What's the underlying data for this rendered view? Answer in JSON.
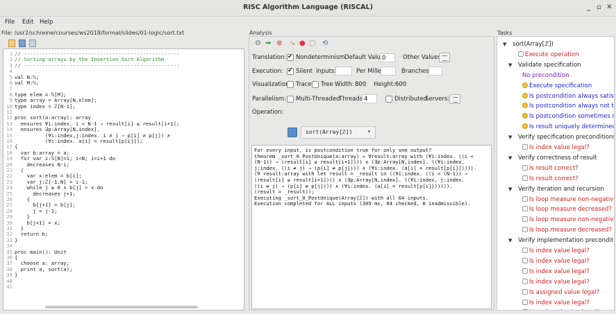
{
  "window": {
    "title": "RISC Algorithm Language (RISCAL)",
    "min_label": "_",
    "max_label": "▫",
    "close_label": "✕"
  },
  "menu": {
    "file": "File",
    "edit": "Edit",
    "help": "Help"
  },
  "editor": {
    "file_label": "File: /usr2/schreine/courses/ws2018/formal/slides/01-logic/sort.txt",
    "lines": [
      {
        "n": "1",
        "t": "// ---------------------------------------------------",
        "k": "comment"
      },
      {
        "n": "2",
        "t": "// Sorting arrays by the Insertion Sort Algorithm",
        "k": "comment"
      },
      {
        "n": "3",
        "t": "// ---------------------------------------------------",
        "k": "comment"
      },
      {
        "n": "4",
        "t": "",
        "k": "code"
      },
      {
        "n": "5",
        "t": "val N:ℕ;",
        "k": "code"
      },
      {
        "n": "6",
        "t": "val M:ℕ;",
        "k": "code"
      },
      {
        "n": "7",
        "t": "",
        "k": "code"
      },
      {
        "n": "8",
        "t": "type elem = ℕ[M];",
        "k": "code"
      },
      {
        "n": "9",
        "t": "type array = Array[N,elem];",
        "k": "code"
      },
      {
        "n": "10",
        "t": "type index = ℤ[N-1];",
        "k": "code"
      },
      {
        "n": "11",
        "t": "",
        "k": "code"
      },
      {
        "n": "12",
        "t": "proc sort(a:array): array",
        "k": "code"
      },
      {
        "n": "13",
        "t": "  ensures ∀i:index. i < N-1 ⇒ result[i] ≤ result[i+1];",
        "k": "code"
      },
      {
        "n": "14",
        "t": "  ensures ∃p:Array[N,index].",
        "k": "code"
      },
      {
        "n": "15",
        "t": "          (∀i:index,j:index. i ≠ j ⇒ p[i] ≠ p[j]) ∧",
        "k": "code"
      },
      {
        "n": "16",
        "t": "          (∀i:index. a[i] = result[p[i]]);",
        "k": "code"
      },
      {
        "n": "17",
        "t": "{",
        "k": "code"
      },
      {
        "n": "18",
        "t": "  var b:array = a;",
        "k": "code"
      },
      {
        "n": "19",
        "t": "  for var i:ℕ[N]=1; i<N; i=i+1 do",
        "k": "code"
      },
      {
        "n": "20",
        "t": "    decreases N-i;",
        "k": "code"
      },
      {
        "n": "21",
        "t": "  {",
        "k": "code"
      },
      {
        "n": "22",
        "t": "    var x:elem = b[i];",
        "k": "code"
      },
      {
        "n": "23",
        "t": "    var j:ℤ[-1,N] = i-1;",
        "k": "code"
      },
      {
        "n": "24",
        "t": "    while j ≥ 0 ∧ b[j] > x do",
        "k": "code"
      },
      {
        "n": "25",
        "t": "      decreases j+1;",
        "k": "code"
      },
      {
        "n": "26",
        "t": "    {",
        "k": "code"
      },
      {
        "n": "27",
        "t": "      b[j+1] = b[j];",
        "k": "code"
      },
      {
        "n": "28",
        "t": "      j = j-1;",
        "k": "code"
      },
      {
        "n": "29",
        "t": "    }",
        "k": "code"
      },
      {
        "n": "30",
        "t": "    b[j+1] = x;",
        "k": "code"
      },
      {
        "n": "31",
        "t": "  }",
        "k": "code"
      },
      {
        "n": "32",
        "t": "  return b;",
        "k": "code"
      },
      {
        "n": "33",
        "t": "}",
        "k": "code"
      },
      {
        "n": "34",
        "t": "",
        "k": "code"
      },
      {
        "n": "35",
        "t": "proc main(): Unit",
        "k": "code"
      },
      {
        "n": "36",
        "t": "{",
        "k": "code"
      },
      {
        "n": "37",
        "t": "  choose a: array;",
        "k": "code"
      },
      {
        "n": "38",
        "t": "  print a, sort(a);",
        "k": "code"
      },
      {
        "n": "39",
        "t": "}",
        "k": "code"
      },
      {
        "n": "40",
        "t": "",
        "k": "code"
      },
      {
        "n": "41",
        "t": "",
        "k": "code"
      }
    ]
  },
  "analysis": {
    "label": "Analysis",
    "translation_label": "Translation:",
    "nondeterminism_label": "Nondeterminism",
    "default_value_label": "Default Value:",
    "default_value": "0",
    "other_values_label": "Other Values:",
    "execution_label": "Execution:",
    "silent_label": "Silent",
    "inputs_label": "Inputs:",
    "per_mille_label": "Per Mille:",
    "branches_label": "Branches:",
    "visualization_label": "Visualization:",
    "trace_label": "Trace",
    "tree_label": "Tree",
    "width_label": "Width:",
    "width_value": "800",
    "height_label": "Height:",
    "height_value": "600",
    "parallelism_label": "Parallelism:",
    "multithreaded_label": "Multi-Threaded",
    "threads_label": "Threads:",
    "threads_value": "4",
    "distributed_label": "Distributed",
    "servers_label": "Servers:",
    "operation_label": "Operation:",
    "operation_value": "sort(Array[ℤ])",
    "output_lines": [
      "For every input, is postcondition true for only one output?",
      "theorem _sort_0_PostUnique(a:array) ⇔ ∀result:array with (∀i:index. ((i <",
      "(N-1)) ⇒ (result[i] ≤ result[i+1]))) ∧ (∃p:Array[N,index]. ((∀i:index,",
      "j:index. ((i ≠ j) ⇒ (p[i] ≠ p[j]))) ∧ (∀i:index. (a[i] = result[p[i]])))).",
      "(∀ result:array with let result = _result in ((∀i:index. ((i < (N-1)) ⇒",
      "(result[i] ≤ result[i+1]))) ∧ (∃p:Array[N,index]. ((∀i:index, j:index.",
      "((i ≠ j) ⇒ (p[i] ≠ p[j]))) ∧ (∀i:index. (a[i] = result[p[i]]))))).",
      "(result = _result));",
      "Executing _sort_0_PostUnique(Array[ℤ]) with all 64 inputs.",
      "Execution completed for ALL inputs (305 ms, 64 checked, 0 inadmissible)."
    ]
  },
  "tasks": {
    "label": "Tasks",
    "items": [
      {
        "text": "sort(Array[ℤ])",
        "color": "black",
        "icon": "",
        "level": 0,
        "tri": "▼"
      },
      {
        "text": "Execute operation",
        "color": "red",
        "icon": "lock",
        "level": 1,
        "tri": ""
      },
      {
        "text": "Validate specification",
        "color": "black",
        "icon": "",
        "level": 1,
        "tri": "▼"
      },
      {
        "text": "No precondition",
        "color": "purple",
        "icon": "",
        "level": 2,
        "tri": ""
      },
      {
        "text": "Execute specification",
        "color": "blue",
        "icon": "gear",
        "level": 2,
        "tri": ""
      },
      {
        "text": "Is postcondition always satisfiable?",
        "color": "blue",
        "icon": "gear",
        "level": 2,
        "tri": ""
      },
      {
        "text": "Is postcondition always not trivial?",
        "color": "blue",
        "icon": "gear",
        "level": 2,
        "tri": ""
      },
      {
        "text": "Is postcondition sometimes not triv",
        "color": "blue",
        "icon": "gear",
        "level": 2,
        "tri": ""
      },
      {
        "text": "Is result uniquely determined?",
        "color": "blue",
        "icon": "gear",
        "level": 2,
        "tri": ""
      },
      {
        "text": "Verify specification preconditions",
        "color": "black",
        "icon": "",
        "level": 1,
        "tri": "▼"
      },
      {
        "text": "Is index value legal?",
        "color": "red",
        "icon": "lock",
        "level": 2,
        "tri": ""
      },
      {
        "text": "Verify correctness of result",
        "color": "black",
        "icon": "",
        "level": 1,
        "tri": "▼"
      },
      {
        "text": "Is result correct?",
        "color": "red",
        "icon": "lock",
        "level": 2,
        "tri": ""
      },
      {
        "text": "Is result correct?",
        "color": "red",
        "icon": "lock",
        "level": 2,
        "tri": ""
      },
      {
        "text": "Verify iteration and recursion",
        "color": "black",
        "icon": "",
        "level": 1,
        "tri": "▼"
      },
      {
        "text": "Is loop measure non-negative?",
        "color": "red",
        "icon": "lock",
        "level": 2,
        "tri": ""
      },
      {
        "text": "Is loop measure decreased?",
        "color": "red",
        "icon": "lock",
        "level": 2,
        "tri": ""
      },
      {
        "text": "Is loop measure non-negative?",
        "color": "red",
        "icon": "lock",
        "level": 2,
        "tri": ""
      },
      {
        "text": "Is loop measure decreased?",
        "color": "red",
        "icon": "lock",
        "level": 2,
        "tri": ""
      },
      {
        "text": "Verify implementation preconditions",
        "color": "black",
        "icon": "",
        "level": 1,
        "tri": "▼"
      },
      {
        "text": "Is index value legal?",
        "color": "red",
        "icon": "lock",
        "level": 2,
        "tri": ""
      },
      {
        "text": "Is index value legal?",
        "color": "red",
        "icon": "lock",
        "level": 2,
        "tri": ""
      },
      {
        "text": "Is index value legal?",
        "color": "red",
        "icon": "lock",
        "level": 2,
        "tri": ""
      },
      {
        "text": "Is index value legal?",
        "color": "red",
        "icon": "lock",
        "level": 2,
        "tri": ""
      },
      {
        "text": "Is assigned value legal?",
        "color": "red",
        "icon": "lock",
        "level": 2,
        "tri": ""
      },
      {
        "text": "Is index value legal?",
        "color": "red",
        "icon": "lock",
        "level": 2,
        "tri": ""
      },
      {
        "text": "Is assigned value legal?",
        "color": "red",
        "icon": "lock",
        "level": 2,
        "tri": ""
      }
    ]
  }
}
